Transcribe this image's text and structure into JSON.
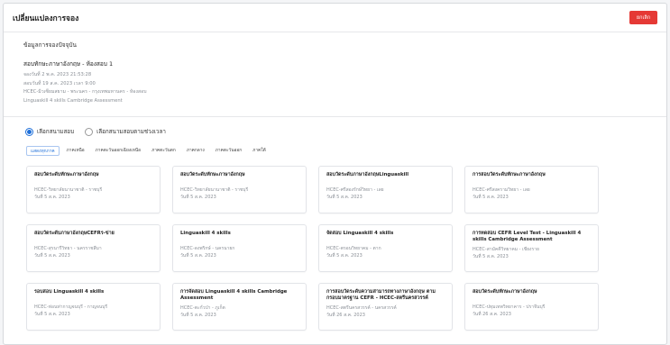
{
  "header": {
    "title": "เปลี่ยนแปลงการจอง",
    "cancel_label": "ยกเลิก"
  },
  "current": {
    "section_label": "ข้อมูลการจองปัจจุบัน",
    "title": "สอบทักษะภาษาอังกฤษ - ห้องสอบ 1",
    "lines": [
      "จองวันที่ 2 พ.ค. 2023 21:53:28",
      "สอบวันที่ 19 ส.ค. 2023 เวลา 9:00",
      "HCEC-มิวเซียมสยาม - พระนคร - กรุงเทพมหานคร - ห้องสอบ",
      "Linguaskill 4 skills Cambridge Assessment"
    ]
  },
  "radios": [
    {
      "label": "เลือกสนามสอบ",
      "checked": true
    },
    {
      "label": "เลือกสนามสอบตามช่วงเวลา",
      "checked": false
    }
  ],
  "region_tabs": [
    {
      "label": "แสดงทุกภาค",
      "active": true
    },
    {
      "label": "ภาคเหนือ",
      "active": false
    },
    {
      "label": "ภาคตะวันออกเฉียงเหนือ",
      "active": false
    },
    {
      "label": "ภาคตะวันตก",
      "active": false
    },
    {
      "label": "ภาคกลาง",
      "active": false
    },
    {
      "label": "ภาคตะวันออก",
      "active": false
    },
    {
      "label": "ภาคใต้",
      "active": false
    }
  ],
  "cards": [
    {
      "title": "สอบวัดระดับทักษะภาษาอังกฤษ",
      "venue": "HCEC-วิทยาลัยนานาชาติ - ราชบุรี",
      "date": "วันที่ 5 ส.ค. 2023"
    },
    {
      "title": "สอบวัดระดับทักษะภาษาอังกฤษ",
      "venue": "HCEC-วิทยาลัยนานาชาติ - ราชบุรี",
      "date": "วันที่ 5 ส.ค. 2023"
    },
    {
      "title": "สอบวัดระดับภาษาอังกฤษLinguaskill",
      "venue": "HCEC-ศรีสองรักษ์วิทยา - เลย",
      "date": "วันที่ 5 ส.ค. 2023"
    },
    {
      "title": "การสอบวัดระดับทักษะภาษาอังกฤษ",
      "venue": "HCEC-ศรีสงครามวิทยา - เลย",
      "date": "วันที่ 5 ส.ค. 2023"
    },
    {
      "title": "สอบวัดระดับภาษาอังกฤษCEFRร-ข่าย",
      "venue": "HCEC-สุรนารีวิทยา - นครราชสีมา",
      "date": "วันที่ 5 ส.ค. 2023"
    },
    {
      "title": "Linguaskill 4 skills",
      "venue": "HCEC-ดงพริกษ์ - นครนายก",
      "date": "วันที่ 5 ส.ค. 2023"
    },
    {
      "title": "จัดสอบ Linguaskill 4 skills",
      "venue": "HCEC-ตรอนวิทยาคม - ตาก",
      "date": "วันที่ 5 ส.ค. 2023"
    },
    {
      "title": "การทดสอบ CEFR Level Test - Linguaskill 4 skills Cambridge Assessment",
      "venue": "HCEC-สามัคคีวิทยาคม - เชียงราย",
      "date": "วันที่ 5 ส.ค. 2023"
    },
    {
      "title": "รอบสอบ Linguaskill 4 skills",
      "venue": "HCEC-ท่อนท่ากาญจนบุรี - กาญจนบุรี",
      "date": "วันที่ 5 ส.ค. 2023"
    },
    {
      "title": "การจัดสอบ Linguaskill 4 skills Cambridge Assessment",
      "venue": "HCEC-ตะกั่วป่า - ภูเก็ต",
      "date": "วันที่ 5 ส.ค. 2023"
    },
    {
      "title": "การสอบวัดระดับความสามารถทางภาษาอังกฤษ ตามกรอบมาตรฐาน CEFR - HCEC-สตรีนครสวรรค์",
      "venue": "HCEC-สตรีนครสวรรค์ - นครสวรรค์",
      "date": "วันที่ 26 ส.ค. 2023"
    },
    {
      "title": "สอบวัดระดับทักษะภาษาอังกฤษ",
      "venue": "HCEC-ปทุมเทพวิทยาคาร - ปราจีนบุรี",
      "date": "วันที่ 26 ส.ค. 2023"
    }
  ]
}
